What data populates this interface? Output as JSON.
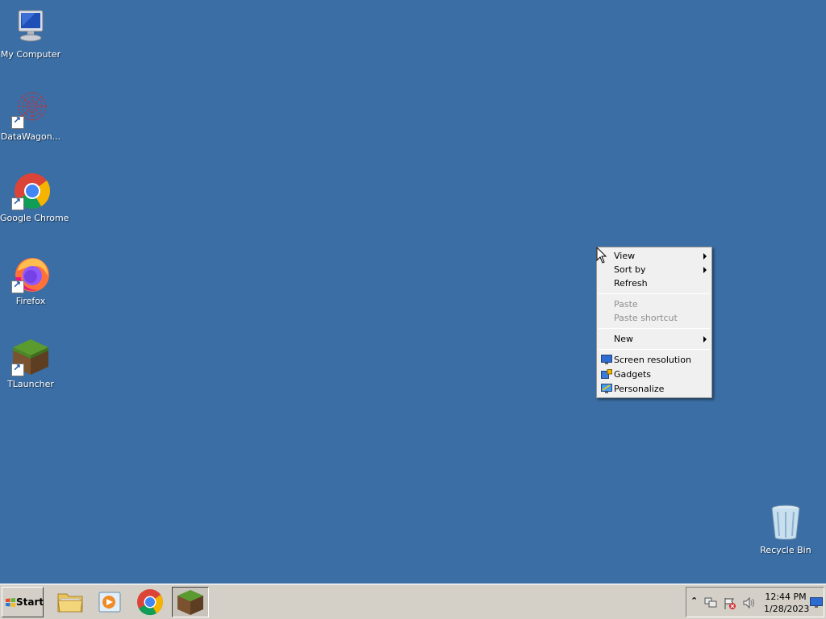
{
  "desktop": {
    "icons": [
      {
        "label": "My Computer",
        "icon": "my-computer-icon"
      },
      {
        "label": "DataWagon...",
        "icon": "datawagon-icon"
      },
      {
        "label": "Google Chrome",
        "icon": "chrome-icon"
      },
      {
        "label": "Firefox",
        "icon": "firefox-icon"
      },
      {
        "label": "TLauncher",
        "icon": "tlauncher-icon"
      }
    ],
    "recycle_bin": {
      "label": "Recycle Bin",
      "icon": "recycle-bin-icon"
    },
    "background_color": "#3a6ea5"
  },
  "context_menu": {
    "view": "View",
    "sort_by": "Sort by",
    "refresh": "Refresh",
    "paste": "Paste",
    "paste_shortcut": "Paste shortcut",
    "new": "New",
    "screen_resolution": "Screen resolution",
    "gadgets": "Gadgets",
    "personalize": "Personalize"
  },
  "taskbar": {
    "start_label": "Start",
    "pinned": [
      {
        "icon": "file-explorer-icon"
      },
      {
        "icon": "media-player-icon"
      },
      {
        "icon": "chrome-icon"
      },
      {
        "icon": "tlauncher-icon",
        "active": true
      }
    ],
    "tray": {
      "time": "12:44 PM",
      "date": "1/28/2023",
      "icons": [
        "show-hidden-icons-icon",
        "network-icon",
        "action-center-icon",
        "volume-icon",
        "show-desktop-icon"
      ]
    }
  }
}
